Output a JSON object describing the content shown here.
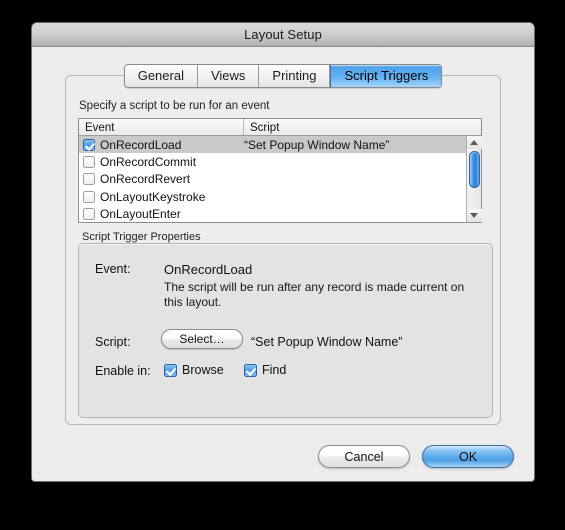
{
  "window": {
    "title": "Layout Setup"
  },
  "tabs": [
    {
      "label": "General",
      "selected": false
    },
    {
      "label": "Views",
      "selected": false
    },
    {
      "label": "Printing",
      "selected": false
    },
    {
      "label": "Script Triggers",
      "selected": true
    }
  ],
  "panel": {
    "hint": "Specify a script to be run for an event",
    "columns": {
      "event": "Event",
      "script": "Script"
    },
    "rows": [
      {
        "event": "OnRecordLoad",
        "script": "“Set Popup Window Name”",
        "checked": true,
        "selected": true
      },
      {
        "event": "OnRecordCommit",
        "script": "",
        "checked": false,
        "selected": false
      },
      {
        "event": "OnRecordRevert",
        "script": "",
        "checked": false,
        "selected": false
      },
      {
        "event": "OnLayoutKeystroke",
        "script": "",
        "checked": false,
        "selected": false
      },
      {
        "event": "OnLayoutEnter",
        "script": "",
        "checked": false,
        "selected": false
      }
    ]
  },
  "properties": {
    "group_label": "Script Trigger Properties",
    "event_label": "Event:",
    "event_value": "OnRecordLoad",
    "event_description": "The script will be run after any record is made current on this layout.",
    "script_label": "Script:",
    "select_button": "Select…",
    "script_value": "“Set Popup Window Name”",
    "enable_label": "Enable in:",
    "enable_options": [
      {
        "label": "Browse",
        "checked": true
      },
      {
        "label": "Find",
        "checked": true
      }
    ]
  },
  "footer": {
    "cancel": "Cancel",
    "ok": "OK"
  },
  "colors": {
    "accent_blue": "#4e9ce4",
    "selection_gray": "#c9c9c9",
    "window_bg": "#ececec"
  }
}
